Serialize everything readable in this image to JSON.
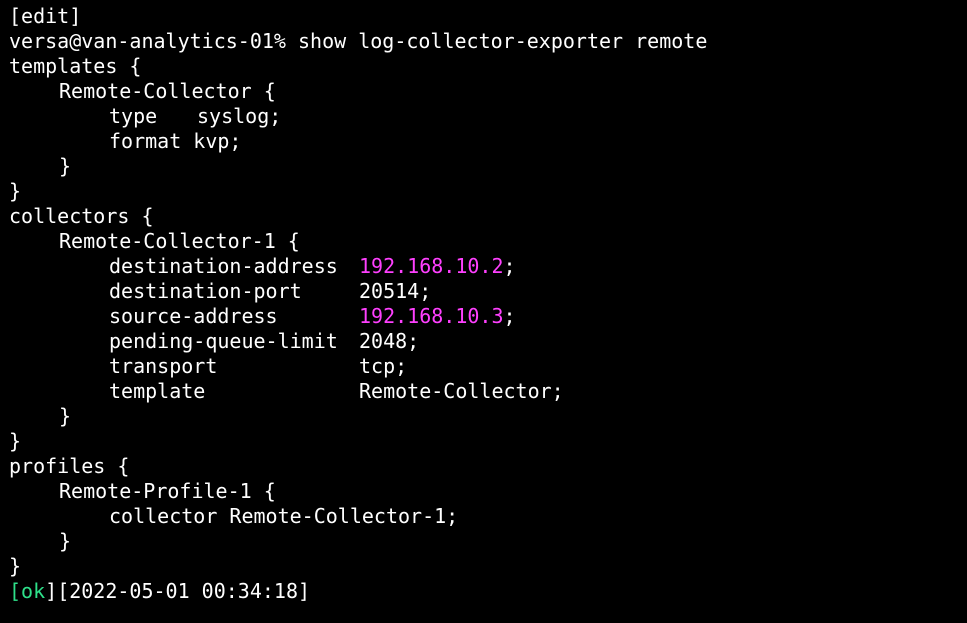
{
  "terminal": {
    "mode": "[edit]",
    "prompt": "versa@van-analytics-01% show log-collector-exporter remote",
    "templates": {
      "open": "templates {",
      "item_open": "Remote-Collector {",
      "type_key": "type",
      "type_val": "syslog;",
      "format_line": "format kvp;",
      "item_close": "}",
      "close": "}"
    },
    "collectors": {
      "open": "collectors {",
      "item_open": "Remote-Collector-1 {",
      "rows": [
        {
          "key": "destination-address",
          "value": "192.168.10.2",
          "suffix": ";"
        },
        {
          "key": "destination-port",
          "value": "20514;",
          "suffix": ""
        },
        {
          "key": "source-address",
          "value": "192.168.10.3",
          "suffix": ";"
        },
        {
          "key": "pending-queue-limit",
          "value": "2048;",
          "suffix": ""
        },
        {
          "key": "transport",
          "value": "tcp;",
          "suffix": ""
        },
        {
          "key": "template",
          "value": "Remote-Collector;",
          "suffix": ""
        }
      ],
      "item_close": "}",
      "close": "}"
    },
    "profiles": {
      "open": "profiles {",
      "item_open": "Remote-Profile-1 {",
      "collector_line": "collector Remote-Collector-1;",
      "item_close": "}",
      "close": "}"
    },
    "status": {
      "open_bracket": "[",
      "ok": "ok",
      "close_bracket": "]",
      "timestamp": "[2022-05-01 00:34:18]"
    },
    "colors": {
      "background": "#000000",
      "text": "#ffffff",
      "ip_highlight": "#ff40ff",
      "ok_green": "#2ee08a"
    }
  }
}
